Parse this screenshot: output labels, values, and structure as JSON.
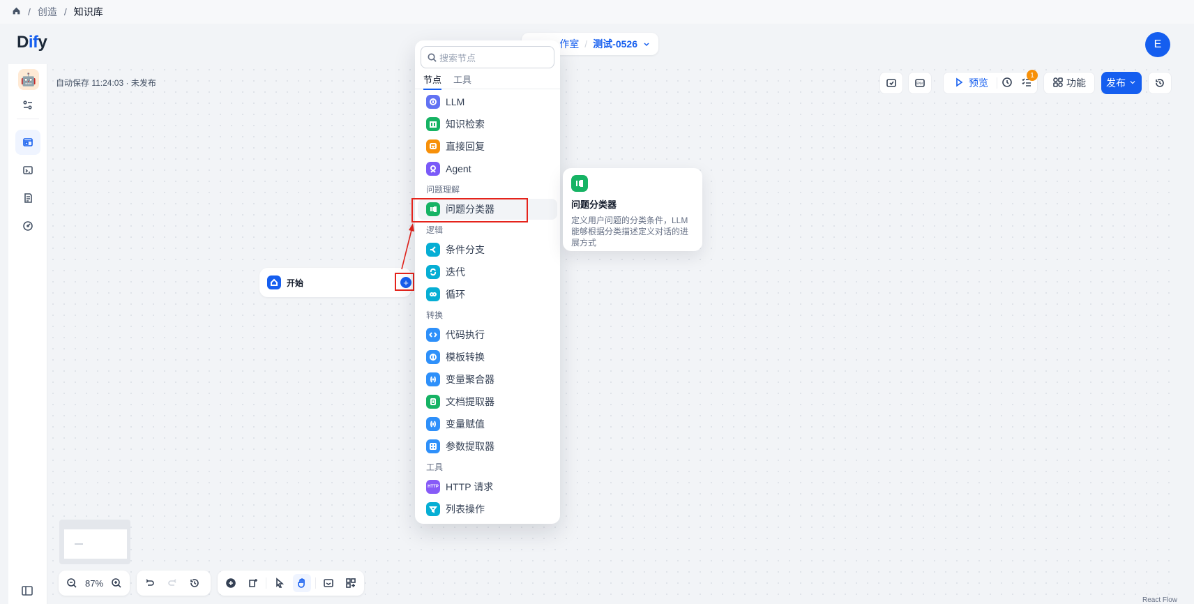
{
  "breadcrumb": {
    "items": [
      "创造",
      "知识库"
    ],
    "separator": "/"
  },
  "header": {
    "logo_prefix": "D",
    "logo_mid": "if",
    "logo_suffix": "y",
    "workspace_fragment": "作室",
    "separator": "/",
    "app_name": "测试-0526",
    "avatar_letter": "E"
  },
  "status": {
    "autosave": "自动保存 11:24:03 · 未发布"
  },
  "toolbar": {
    "preview_label": "预览",
    "checklist_badge": "1",
    "features_label": "功能",
    "publish_label": "发布"
  },
  "start_node": {
    "title": "开始"
  },
  "node_picker": {
    "search_placeholder": "搜索节点",
    "tabs": [
      "节点",
      "工具"
    ],
    "active_tab": "节点",
    "groups": {
      "understanding": "问题理解",
      "logic": "逻辑",
      "transform": "转换",
      "tools": "工具"
    },
    "items": [
      {
        "label": "LLM",
        "icon": "llm-icon",
        "color": "#6172f3"
      },
      {
        "label": "知识检索",
        "icon": "knowledge-retrieval-icon",
        "color": "#16b364"
      },
      {
        "label": "直接回复",
        "icon": "answer-icon",
        "color": "#f79009"
      },
      {
        "label": "Agent",
        "icon": "agent-icon",
        "color": "#7a5af8"
      },
      {
        "label": "问题分类器",
        "icon": "question-classifier-icon",
        "color": "#16b364"
      },
      {
        "label": "条件分支",
        "icon": "if-else-icon",
        "color": "#06aed4"
      },
      {
        "label": "迭代",
        "icon": "iteration-icon",
        "color": "#06aed4"
      },
      {
        "label": "循环",
        "icon": "loop-icon",
        "color": "#06aed4"
      },
      {
        "label": "代码执行",
        "icon": "code-icon",
        "color": "#2e90fa"
      },
      {
        "label": "模板转换",
        "icon": "template-icon",
        "color": "#2e90fa"
      },
      {
        "label": "变量聚合器",
        "icon": "variable-aggregator-icon",
        "color": "#2e90fa"
      },
      {
        "label": "文档提取器",
        "icon": "doc-extractor-icon",
        "color": "#16b364"
      },
      {
        "label": "变量赋值",
        "icon": "assigner-icon",
        "color": "#2e90fa"
      },
      {
        "label": "参数提取器",
        "icon": "parameter-extractor-icon",
        "color": "#2e90fa"
      },
      {
        "label": "HTTP 请求",
        "icon": "http-icon",
        "color": "#875bf7"
      },
      {
        "label": "列表操作",
        "icon": "list-operator-icon",
        "color": "#06aed4"
      }
    ],
    "highlighted": "问题分类器"
  },
  "tooltip": {
    "title": "问题分类器",
    "description": "定义用户问题的分类条件，LLM 能够根据分类描述定义对话的进展方式"
  },
  "zoom": {
    "level": "87%"
  },
  "footer": {
    "react_flow": "React Flow"
  }
}
